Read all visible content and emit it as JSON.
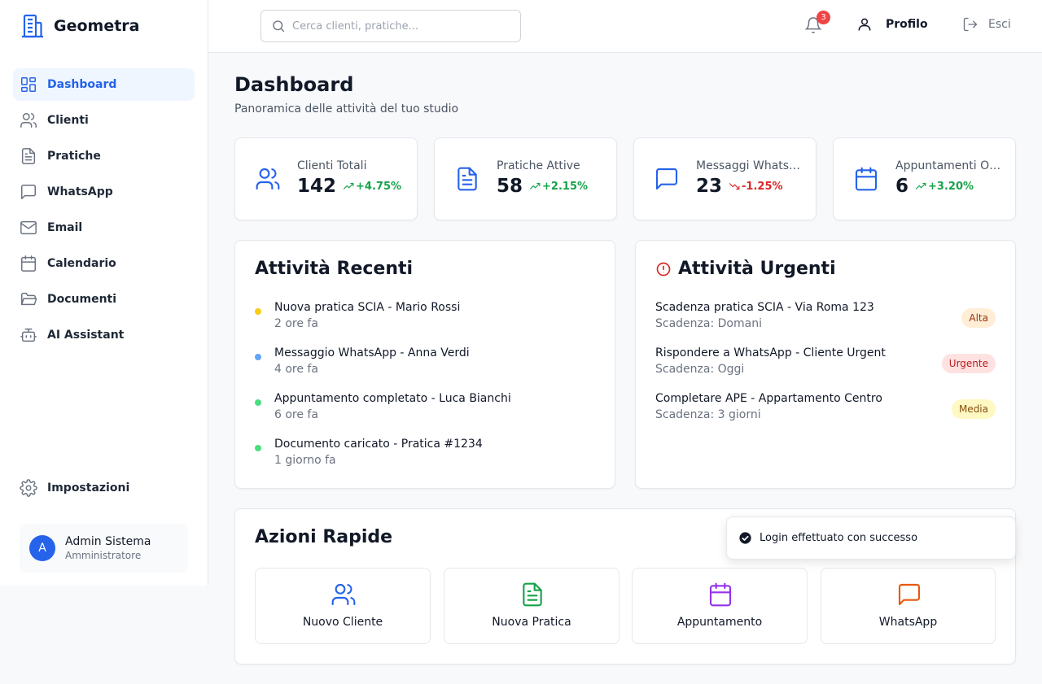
{
  "app": {
    "name": "Geometra"
  },
  "sidebar": {
    "items": [
      {
        "label": "Dashboard",
        "icon": "dashboard-icon",
        "active": true
      },
      {
        "label": "Clienti",
        "icon": "users-icon"
      },
      {
        "label": "Pratiche",
        "icon": "file-icon"
      },
      {
        "label": "WhatsApp",
        "icon": "message-icon"
      },
      {
        "label": "Email",
        "icon": "mail-icon"
      },
      {
        "label": "Calendario",
        "icon": "calendar-icon"
      },
      {
        "label": "Documenti",
        "icon": "folder-icon"
      },
      {
        "label": "AI Assistant",
        "icon": "bot-icon"
      }
    ],
    "settings_label": "Impostazioni",
    "user": {
      "initial": "A",
      "name": "Admin Sistema",
      "role": "Amministratore"
    }
  },
  "header": {
    "search_placeholder": "Cerca clienti, pratiche...",
    "notifications_count": "3",
    "profile_label": "Profilo",
    "logout_label": "Esci"
  },
  "page": {
    "title": "Dashboard",
    "subtitle": "Panoramica delle attività del tuo studio"
  },
  "stats": [
    {
      "label": "Clienti Totali",
      "value": "142",
      "trend": "+4.75%",
      "direction": "up",
      "icon": "users-icon"
    },
    {
      "label": "Pratiche Attive",
      "value": "58",
      "trend": "+2.15%",
      "direction": "up",
      "icon": "file-icon"
    },
    {
      "label": "Messaggi Whats…",
      "value": "23",
      "trend": "-1.25%",
      "direction": "down",
      "icon": "message-icon"
    },
    {
      "label": "Appuntamenti O…",
      "value": "6",
      "trend": "+3.20%",
      "direction": "up",
      "icon": "calendar-icon"
    }
  ],
  "recent": {
    "title": "Attività Recenti",
    "items": [
      {
        "title": "Nuova pratica SCIA - Mario Rossi",
        "time": "2 ore fa",
        "color": "#facc15"
      },
      {
        "title": "Messaggio WhatsApp - Anna Verdi",
        "time": "4 ore fa",
        "color": "#60a5fa"
      },
      {
        "title": "Appuntamento completato - Luca Bianchi",
        "time": "6 ore fa",
        "color": "#4ade80"
      },
      {
        "title": "Documento caricato - Pratica #1234",
        "time": "1 giorno fa",
        "color": "#4ade80"
      }
    ]
  },
  "urgent": {
    "title": "Attività Urgenti",
    "items": [
      {
        "title": "Scadenza pratica SCIA - Via Roma 123",
        "due": "Scadenza: Domani",
        "priority": "Alta",
        "bg": "#ffedd5",
        "fg": "#9a3412"
      },
      {
        "title": "Rispondere a WhatsApp - Cliente Urgent",
        "due": "Scadenza: Oggi",
        "priority": "Urgente",
        "bg": "#fee2e2",
        "fg": "#b91c1c"
      },
      {
        "title": "Completare APE - Appartamento Centro",
        "due": "Scadenza: 3 giorni",
        "priority": "Media",
        "bg": "#fef9c3",
        "fg": "#854d0e"
      }
    ]
  },
  "quick": {
    "title": "Azioni Rapide",
    "actions": [
      {
        "label": "Nuovo Cliente",
        "icon": "users-icon",
        "color": "#2563eb"
      },
      {
        "label": "Nuova Pratica",
        "icon": "file-icon",
        "color": "#16a34a"
      },
      {
        "label": "Appuntamento",
        "icon": "calendar-icon",
        "color": "#9333ea"
      },
      {
        "label": "WhatsApp",
        "icon": "message-icon",
        "color": "#ea580c"
      }
    ]
  },
  "toast": {
    "message": "Login effettuato con successo"
  },
  "colors": {
    "accent": "#2563eb",
    "up": "#16a34a",
    "down": "#dc2626"
  }
}
